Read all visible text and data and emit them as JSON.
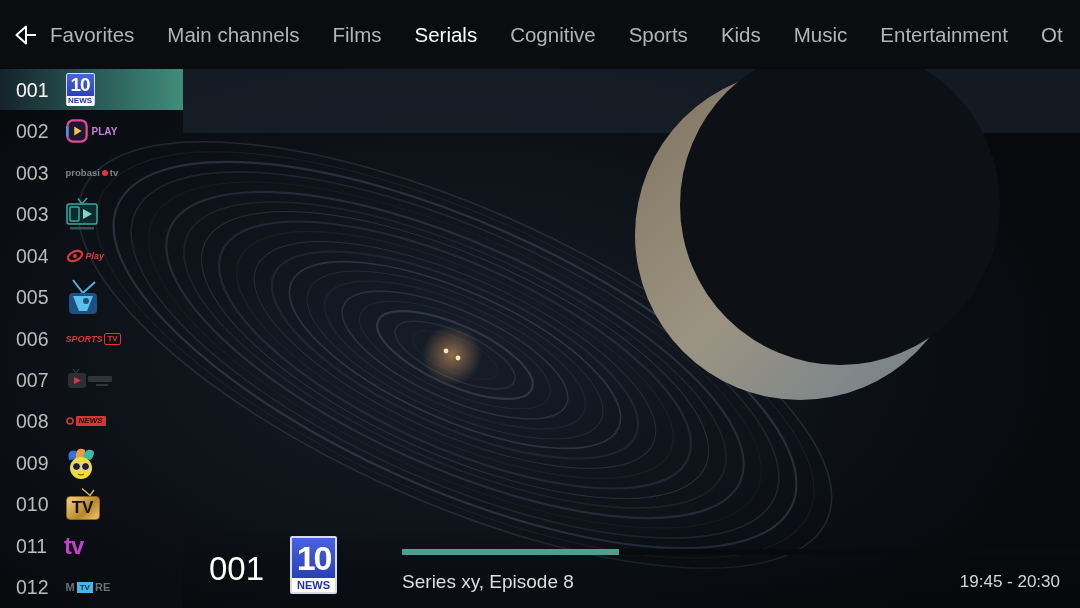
{
  "tabs": [
    {
      "label": "Favorites",
      "selected": false
    },
    {
      "label": "Main channels",
      "selected": false
    },
    {
      "label": "Films",
      "selected": false
    },
    {
      "label": "Serials",
      "selected": true
    },
    {
      "label": "Cognitive",
      "selected": false
    },
    {
      "label": "Sports",
      "selected": false
    },
    {
      "label": "Kids",
      "selected": false
    },
    {
      "label": "Music",
      "selected": false
    },
    {
      "label": "Entertainment",
      "selected": false
    },
    {
      "label": "Ot",
      "selected": false
    }
  ],
  "channels": [
    {
      "number": "001",
      "selected": true,
      "logo": {
        "kind": "news-badge",
        "texts": [
          "10",
          "NEWS"
        ]
      }
    },
    {
      "number": "002",
      "selected": false,
      "logo": {
        "kind": "play",
        "texts": [
          "PLAY"
        ]
      }
    },
    {
      "number": "003",
      "selected": false,
      "logo": {
        "kind": "dot-wordmark",
        "texts": [
          "probasi",
          "tv"
        ]
      }
    },
    {
      "number": "003",
      "selected": false,
      "logo": {
        "kind": "screen-tv"
      }
    },
    {
      "number": "004",
      "selected": false,
      "logo": {
        "kind": "ring",
        "texts": [
          "Play"
        ]
      }
    },
    {
      "number": "005",
      "selected": false,
      "logo": {
        "kind": "antenna-tv"
      }
    },
    {
      "number": "006",
      "selected": false,
      "logo": {
        "kind": "sports",
        "texts": [
          "SPORTS",
          "TV"
        ]
      }
    },
    {
      "number": "007",
      "selected": false,
      "logo": {
        "kind": "play-box"
      }
    },
    {
      "number": "008",
      "selected": false,
      "logo": {
        "kind": "news-tag",
        "texts": [
          "NEWS"
        ]
      }
    },
    {
      "number": "009",
      "selected": false,
      "logo": {
        "kind": "mascot"
      }
    },
    {
      "number": "010",
      "selected": false,
      "logo": {
        "kind": "framed-tv",
        "texts": [
          "TV"
        ]
      }
    },
    {
      "number": "011",
      "selected": false,
      "logo": {
        "kind": "tv-wordmark",
        "texts": [
          "tv"
        ]
      }
    },
    {
      "number": "012",
      "selected": false,
      "logo": {
        "kind": "more-tv",
        "texts": [
          "M",
          "TV",
          "RE"
        ]
      }
    }
  ],
  "now_playing": {
    "number": "001",
    "logo": {
      "kind": "news-badge",
      "texts": [
        "10",
        "NEWS"
      ]
    },
    "progress": {
      "level": 0.32
    },
    "title": "Series xy, Episode 8",
    "time": "19:45 - 20:30"
  }
}
